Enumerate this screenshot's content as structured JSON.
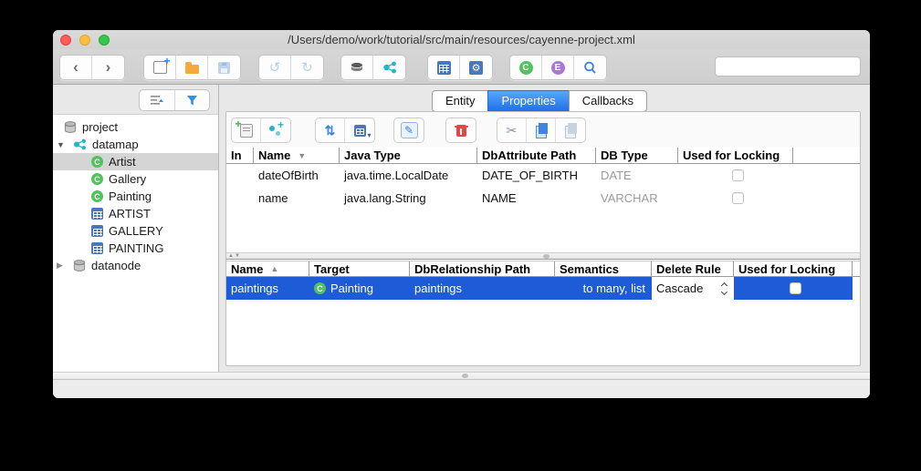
{
  "window": {
    "title": "/Users/demo/work/tutorial/src/main/resources/cayenne-project.xml"
  },
  "main_toolbar": {
    "back_glyph": "‹",
    "forward_glyph": "›",
    "objentity_letter": "C",
    "embeddable_letter": "E",
    "search_value": ""
  },
  "sidebar": {
    "tree": [
      {
        "label": "project",
        "icon": "database-icon",
        "level": 0,
        "expander": ""
      },
      {
        "label": "datamap",
        "icon": "datamap-icon",
        "level": 1,
        "expander": "▼"
      },
      {
        "label": "Artist",
        "icon": "objentity-icon",
        "level": 2,
        "selected": true
      },
      {
        "label": "Gallery",
        "icon": "objentity-icon",
        "level": 2
      },
      {
        "label": "Painting",
        "icon": "objentity-icon",
        "level": 2
      },
      {
        "label": "ARTIST",
        "icon": "dbentity-icon",
        "level": 2
      },
      {
        "label": "GALLERY",
        "icon": "dbentity-icon",
        "level": 2
      },
      {
        "label": "PAINTING",
        "icon": "dbentity-icon",
        "level": 2
      },
      {
        "label": "datanode",
        "icon": "database-icon",
        "level": 1,
        "expander": "▶"
      }
    ]
  },
  "tabs": {
    "items": [
      {
        "label": "Entity"
      },
      {
        "label": "Properties"
      },
      {
        "label": "Callbacks"
      }
    ],
    "active": "Properties"
  },
  "attributes": {
    "columns": {
      "in": "In",
      "name": "Name",
      "java_type": "Java Type",
      "db_attribute_path": "DbAttribute Path",
      "db_type": "DB Type",
      "locking": "Used for Locking"
    },
    "sort_column": "Name",
    "sort_indicator": "▼",
    "rows": [
      {
        "in": "",
        "name": "dateOfBirth",
        "java_type": "java.time.LocalDate",
        "db_attribute_path": "DATE_OF_BIRTH",
        "db_type": "DATE",
        "locking_checked": false
      },
      {
        "in": "",
        "name": "name",
        "java_type": "java.lang.String",
        "db_attribute_path": "NAME",
        "db_type": "VARCHAR",
        "locking_checked": false
      }
    ]
  },
  "relationships": {
    "columns": {
      "name": "Name",
      "target": "Target",
      "path": "DbRelationship Path",
      "semantics": "Semantics",
      "delete_rule": "Delete Rule",
      "locking": "Used for Locking"
    },
    "sort_column": "Name",
    "sort_indicator": "▲",
    "rows": [
      {
        "name": "paintings",
        "target": "Painting",
        "target_icon": "objentity-icon",
        "path": "paintings",
        "semantics": "to many, list",
        "delete_rule": "Cascade",
        "locking_checked": false,
        "selected": true
      }
    ]
  },
  "colors": {
    "selection_blue": "#1d5cd6",
    "tab_active_blue": "#2f83f2",
    "objentity_green": "#53c25e",
    "dbentity_blue": "#4a76bb",
    "embeddable_purple": "#a878d2",
    "datamap_teal": "#28b4c8",
    "folder_orange": "#f3a93b",
    "delete_red": "#e04747"
  }
}
